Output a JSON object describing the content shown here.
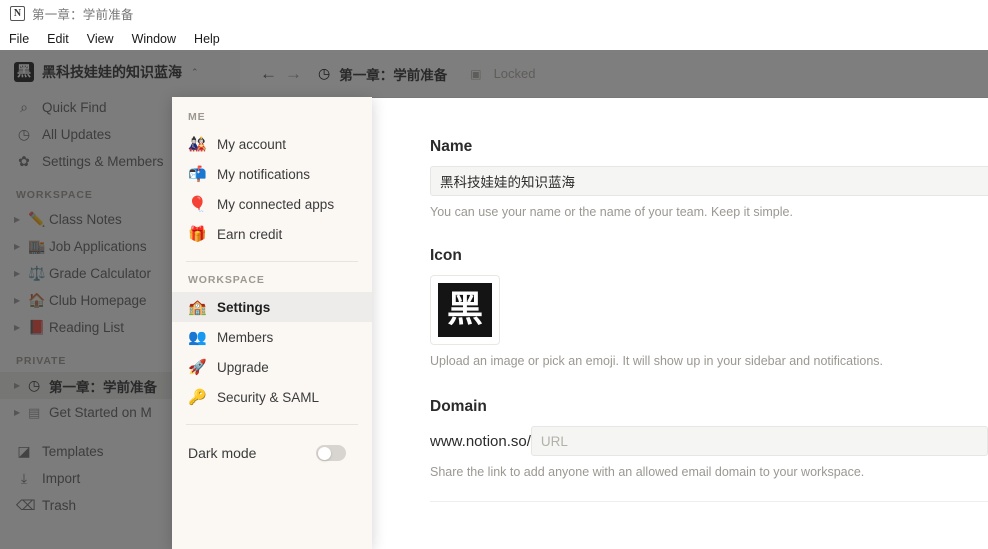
{
  "window": {
    "logo_glyph": "N",
    "title": "第一章：学前准备"
  },
  "menubar": {
    "items": [
      {
        "label": "File"
      },
      {
        "label": "Edit"
      },
      {
        "label": "View"
      },
      {
        "label": "Window"
      },
      {
        "label": "Help"
      }
    ]
  },
  "sidebar": {
    "workspace": {
      "icon_glyph": "黑",
      "name": "黑科技娃娃的知识蓝海",
      "caret": "⌃⌄"
    },
    "nav": [
      {
        "icon": "search-icon",
        "glyph": "🔍",
        "label": "Quick Find"
      },
      {
        "icon": "clock-icon",
        "glyph": "🕘",
        "label": "All Updates"
      },
      {
        "icon": "gear-icon",
        "glyph": "⚙",
        "label": "Settings & Members"
      }
    ],
    "workspace_section_label": "WORKSPACE",
    "workspace_pages": [
      {
        "emoji": "✏️",
        "label": "Class Notes"
      },
      {
        "emoji": "🏬",
        "label": "Job Applications"
      },
      {
        "emoji": "⚖️",
        "label": "Grade Calculator"
      },
      {
        "emoji": "🏠",
        "label": "Club Homepage"
      },
      {
        "emoji": "📕",
        "label": "Reading List"
      }
    ],
    "private_section_label": "PRIVATE",
    "private_pages": [
      {
        "emoji": "🕘",
        "label": "第一章：学前准备",
        "active": true
      },
      {
        "emoji": "📄",
        "label": "Get Started on M",
        "active": false
      }
    ],
    "bottom": [
      {
        "icon": "templates-icon",
        "glyph": "⬗",
        "label": "Templates"
      },
      {
        "icon": "import-icon",
        "glyph": "⤓",
        "label": "Import"
      },
      {
        "icon": "trash-icon",
        "glyph": "🗑",
        "label": "Trash"
      }
    ]
  },
  "topbar": {
    "back_arrow": "←",
    "forward_arrow": "→",
    "page_emoji": "🕘",
    "page_title": "第一章：学前准备",
    "lock_glyph": "🔒",
    "locked_label": "Locked"
  },
  "settings": {
    "name": {
      "title": "Name",
      "value": "黑科技娃娃的知识蓝海",
      "help": "You can use your name or the name of your team. Keep it simple."
    },
    "icon": {
      "title": "Icon",
      "glyph": "黑",
      "help": "Upload an image or pick an emoji. It will show up in your sidebar and notifications."
    },
    "domain": {
      "title": "Domain",
      "prefix": "www.notion.so/",
      "placeholder": "URL",
      "value": "",
      "help": "Share the link to add anyone with an allowed email domain to your workspace."
    }
  },
  "menu": {
    "me_label": "ME",
    "me_items": [
      {
        "emoji": "🎎",
        "label": "My account"
      },
      {
        "emoji": "📬",
        "label": "My notifications"
      },
      {
        "emoji": "🎈",
        "label": "My connected apps"
      },
      {
        "emoji": "🎁",
        "label": "Earn credit"
      }
    ],
    "workspace_label": "WORKSPACE",
    "workspace_items": [
      {
        "emoji": "🏫",
        "label": "Settings",
        "selected": true
      },
      {
        "emoji": "👥",
        "label": "Members",
        "selected": false
      },
      {
        "emoji": "🚀",
        "label": "Upgrade",
        "selected": false
      },
      {
        "emoji": "🔑",
        "label": "Security & SAML",
        "selected": false
      }
    ],
    "dark_mode_label": "Dark mode",
    "dark_mode_on": false
  },
  "colors": {
    "panel_bg": "#fbf8f4",
    "sidebar_bg": "#fbfaf9",
    "input_bg": "#f5f6f3",
    "selected_bg": "#edeceb",
    "dim": "rgba(40,40,40,0.60)"
  }
}
